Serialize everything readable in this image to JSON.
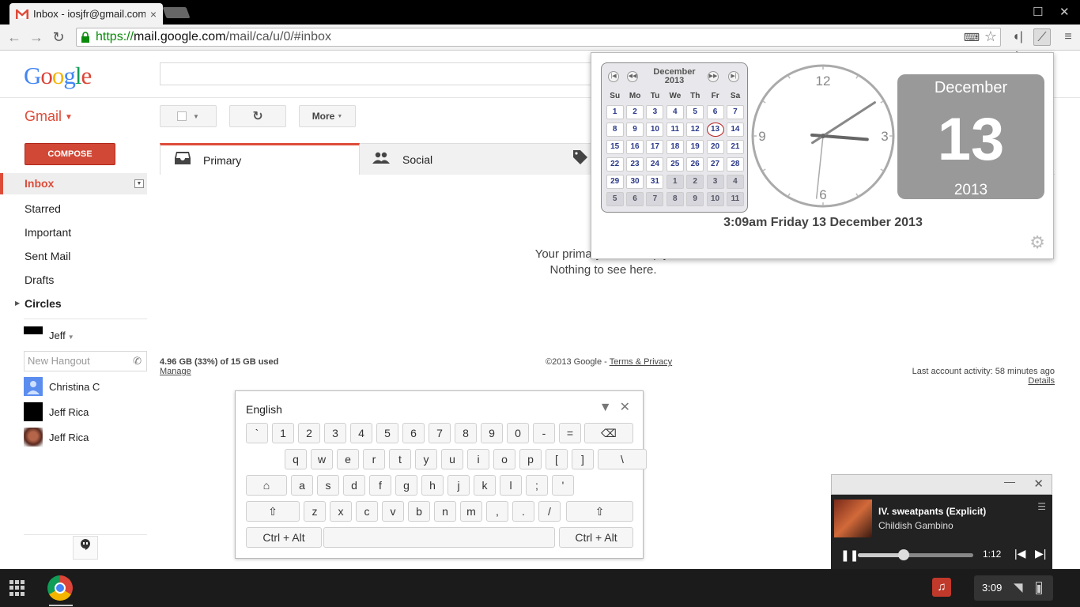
{
  "browser": {
    "tab_title": "Inbox - iosjfr@gmail.com",
    "tab_close": "×",
    "url_scheme": "https://",
    "url_host": "mail.google.com",
    "url_path": "/mail/ca/u/0/#inbox"
  },
  "gmail": {
    "logo": "Google",
    "app_label": "Gmail",
    "compose_label": "COMPOSE",
    "more_label": "More",
    "nav": [
      "Inbox",
      "Starred",
      "Important",
      "Sent Mail",
      "Drafts",
      "Circles"
    ],
    "me_name": "Jeff",
    "hangout_placeholder": "New Hangout",
    "contacts": [
      "Christina C",
      "Jeff Rica",
      "Jeff Rica"
    ],
    "tabs": [
      "Primary",
      "Social"
    ],
    "empty_line1": "Your primary tab is empty.",
    "empty_line2": "Nothing to see here.",
    "storage_used": "4.96 GB (33%) of 15 GB used",
    "storage_manage": "Manage",
    "copyright": "©2013 Google - ",
    "terms": "Terms & Privacy",
    "last_activity": "Last account activity: 58 minutes ago",
    "details": "Details"
  },
  "clock": {
    "month_year_month": "December",
    "month_year_year": "2013",
    "dow": [
      "Su",
      "Mo",
      "Tu",
      "We",
      "Th",
      "Fr",
      "Sa"
    ],
    "weeks": [
      [
        1,
        2,
        3,
        4,
        5,
        6,
        7
      ],
      [
        8,
        9,
        10,
        11,
        12,
        13,
        14
      ],
      [
        15,
        16,
        17,
        18,
        19,
        20,
        21
      ],
      [
        22,
        23,
        24,
        25,
        26,
        27,
        28
      ],
      [
        29,
        30,
        31,
        1,
        2,
        3,
        4
      ],
      [
        5,
        6,
        7,
        8,
        9,
        10,
        11
      ]
    ],
    "today": 13,
    "face_numbers": [
      "12",
      "3",
      "6",
      "9"
    ],
    "tile_month": "December",
    "tile_day": "13",
    "tile_year": "2013",
    "readout": "3:09am Friday 13 December 2013",
    "hour": 3,
    "minute": 9,
    "second": 31
  },
  "keyboard": {
    "language": "English",
    "row1": [
      "`",
      "1",
      "2",
      "3",
      "4",
      "5",
      "6",
      "7",
      "8",
      "9",
      "0",
      "-",
      "="
    ],
    "row2": [
      "q",
      "w",
      "e",
      "r",
      "t",
      "y",
      "u",
      "i",
      "o",
      "p",
      "[",
      "]",
      "\\"
    ],
    "row3": [
      "a",
      "s",
      "d",
      "f",
      "g",
      "h",
      "j",
      "k",
      "l",
      ";",
      "'"
    ],
    "row4": [
      "z",
      "x",
      "c",
      "v",
      "b",
      "n",
      "m",
      ",",
      ".",
      "/"
    ],
    "modifier": "Ctrl + Alt"
  },
  "player": {
    "song": "IV. sweatpants (Explicit)",
    "artist": "Childish Gambino",
    "time": "1:12",
    "progress": 0.4
  },
  "shelf": {
    "time": "3:09"
  },
  "colors": {
    "gmail_red": "#dd4b39",
    "compose": "#d14836",
    "today_ring": "#bb2222"
  }
}
